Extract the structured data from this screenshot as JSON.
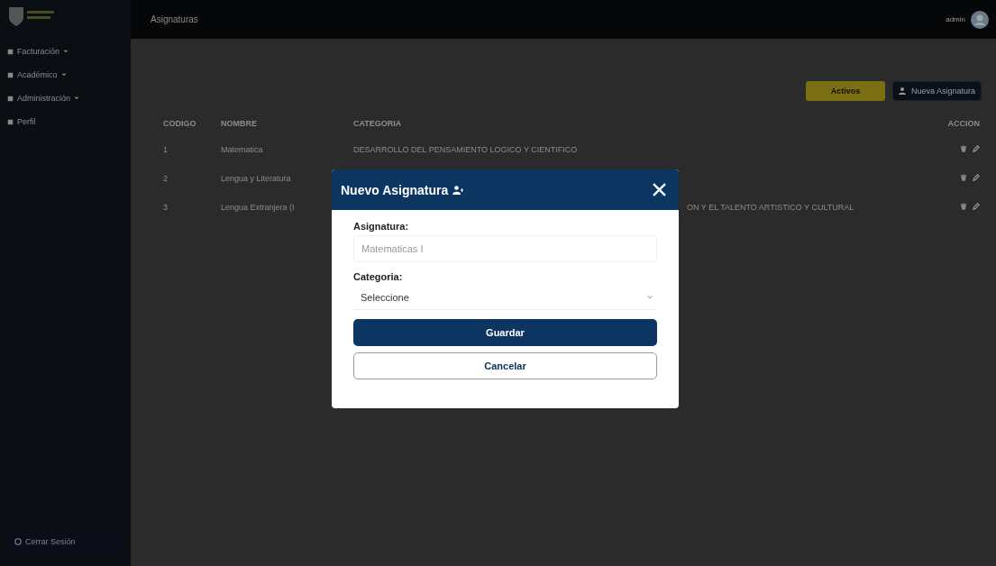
{
  "topbar": {
    "title": "Asignaturas",
    "user": "admin"
  },
  "sidebar": {
    "items": [
      {
        "label": "Facturación",
        "expandable": true
      },
      {
        "label": "Académico",
        "expandable": true
      },
      {
        "label": "Administración",
        "expandable": true
      },
      {
        "label": "Perfil",
        "expandable": false
      }
    ],
    "logout": "Cerrar Sesión"
  },
  "toolbar": {
    "filter": "Activos",
    "new_button": "Nueva Asignatura"
  },
  "table": {
    "columns": [
      "CODIGO",
      "NOMBRE",
      "CATEGORIA",
      "ACCION"
    ],
    "rows": [
      {
        "code": "1",
        "name": "Matematica",
        "category": "DESARROLLO DEL PENSAMIENTO LOGICO Y CIENTIFICO"
      },
      {
        "code": "2",
        "name": "Lengua y Literatura"
      },
      {
        "code": "3",
        "name": "Lengua Extranjera (I",
        "category": "ON Y EL TALENTO ARTISTICO Y CULTURAL"
      }
    ]
  },
  "modal": {
    "title": "Nuevo Asignatura",
    "fields": [
      {
        "kind": "text",
        "label": "Asignatura:",
        "placeholder": "Matematicas I"
      },
      {
        "kind": "select",
        "label": "Categoria:",
        "value": "Seleccione"
      }
    ],
    "buttons": [
      {
        "kind": "primary",
        "label": "Guardar"
      },
      {
        "kind": "outline",
        "label": "Cancelar"
      }
    ]
  }
}
